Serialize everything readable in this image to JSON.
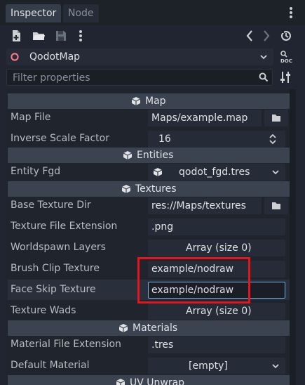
{
  "tabs": {
    "inspector": "Inspector",
    "node": "Node"
  },
  "object": {
    "name": "QodotMap"
  },
  "filter": {
    "placeholder": "Filter properties"
  },
  "sections": {
    "map": "Map",
    "entities": "Entities",
    "textures": "Textures",
    "materials": "Materials",
    "uv_unwrap": "UV Unwrap"
  },
  "properties": {
    "map_file": {
      "label": "Map File",
      "value": "Maps/example.map"
    },
    "inverse_scale_factor": {
      "label": "Inverse Scale Factor",
      "value": "16"
    },
    "entity_fgd": {
      "label": "Entity Fgd",
      "value": "qodot_fgd.tres"
    },
    "base_texture_dir": {
      "label": "Base Texture Dir",
      "value": "res://Maps/textures"
    },
    "texture_file_extension": {
      "label": "Texture File Extension",
      "value": ".png"
    },
    "worldspawn_layers": {
      "label": "Worldspawn Layers",
      "value": "Array (size 0)"
    },
    "brush_clip_texture": {
      "label": "Brush Clip Texture",
      "value": "example/nodraw"
    },
    "face_skip_texture": {
      "label": "Face Skip Texture",
      "value": "example/nodraw"
    },
    "texture_wads": {
      "label": "Texture Wads",
      "value": "Array (size 0)"
    },
    "material_file_extension": {
      "label": "Material File Extension",
      "value": ".tres"
    },
    "default_material": {
      "label": "Default Material",
      "value": "[empty]"
    }
  },
  "colors": {
    "annotation_red": "#e8141b",
    "accent_blue": "#6faedf"
  },
  "icons": [
    "new-script-icon",
    "open-folder-icon",
    "save-icon",
    "more-icon",
    "history-back-icon",
    "history-forward-icon",
    "history-icon",
    "node-type-icon",
    "dropdown-icon",
    "docs-icon",
    "search-icon",
    "settings-icon",
    "folder-icon",
    "cube-icon",
    "spinbox-arrows-icon"
  ]
}
